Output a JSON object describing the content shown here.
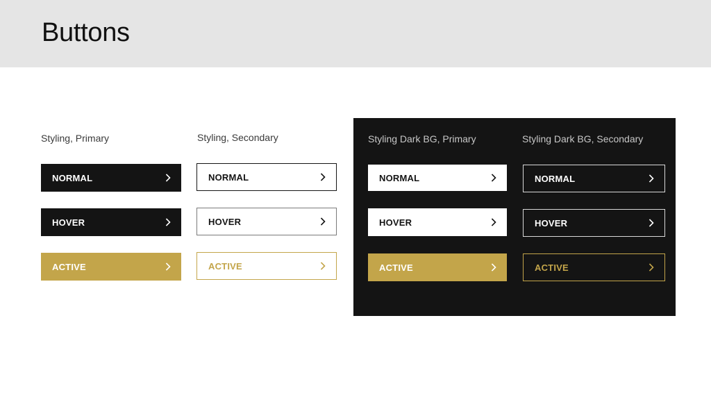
{
  "page": {
    "title": "Buttons"
  },
  "colors": {
    "header_bg": "#e5e5e5",
    "dark": "#141414",
    "gold": "#c3a54a",
    "white": "#ffffff"
  },
  "columns": [
    {
      "label": "Styling, Primary",
      "buttons": [
        {
          "state": "normal",
          "label": "NORMAL",
          "icon": "chevron-right-icon"
        },
        {
          "state": "hover",
          "label": "HOVER",
          "icon": "chevron-right-icon"
        },
        {
          "state": "active",
          "label": "ACTIVE",
          "icon": "chevron-right-icon"
        }
      ]
    },
    {
      "label": "Styling, Secondary",
      "buttons": [
        {
          "state": "normal",
          "label": "NORMAL",
          "icon": "chevron-right-icon"
        },
        {
          "state": "hover",
          "label": "HOVER",
          "icon": "chevron-right-icon"
        },
        {
          "state": "active",
          "label": "ACTIVE",
          "icon": "chevron-right-icon"
        }
      ]
    },
    {
      "label": "Styling Dark BG, Primary",
      "buttons": [
        {
          "state": "normal",
          "label": "NORMAL",
          "icon": "chevron-right-icon"
        },
        {
          "state": "hover",
          "label": "HOVER",
          "icon": "chevron-right-icon"
        },
        {
          "state": "active",
          "label": "ACTIVE",
          "icon": "chevron-right-icon"
        }
      ]
    },
    {
      "label": "Styling Dark BG, Secondary",
      "buttons": [
        {
          "state": "normal",
          "label": "NORMAL",
          "icon": "chevron-right-icon"
        },
        {
          "state": "hover",
          "label": "HOVER",
          "icon": "chevron-right-icon"
        },
        {
          "state": "active",
          "label": "ACTIVE",
          "icon": "chevron-right-icon"
        }
      ]
    }
  ]
}
